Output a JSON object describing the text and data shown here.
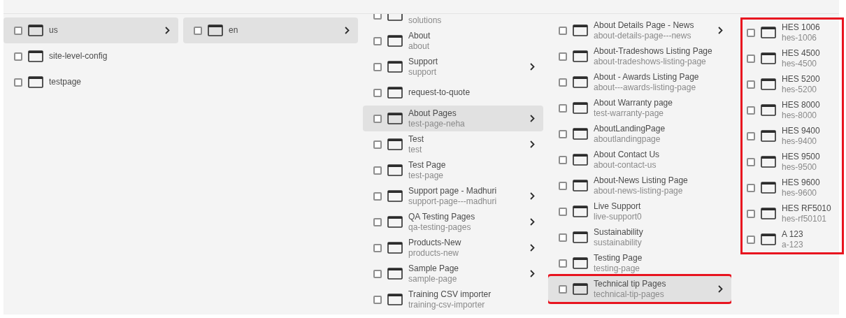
{
  "columns": [
    {
      "highlighted": false,
      "offset": false,
      "items": [
        {
          "title": "us",
          "selected": true,
          "checked": false,
          "has_children": true
        },
        {
          "title": "site-level-config",
          "selected": false,
          "checked": false,
          "has_children": false
        },
        {
          "title": "testpage",
          "selected": false,
          "checked": false,
          "has_children": false
        }
      ]
    },
    {
      "highlighted": false,
      "offset": false,
      "items": [
        {
          "title": "en",
          "selected": true,
          "checked": false,
          "has_children": true
        }
      ]
    },
    {
      "highlighted": false,
      "offset": true,
      "items": [
        {
          "path": "solutions",
          "selected": false,
          "checked": false,
          "has_children": false
        },
        {
          "title": "About",
          "path": "about",
          "selected": false,
          "checked": false,
          "has_children": false
        },
        {
          "title": "Support",
          "path": "support",
          "selected": false,
          "checked": false,
          "has_children": true
        },
        {
          "title": "request-to-quote",
          "selected": false,
          "checked": false,
          "has_children": false
        },
        {
          "title": "About Pages",
          "path": "test-page-neha",
          "selected": true,
          "checked": false,
          "has_children": true
        },
        {
          "title": "Test",
          "path": "test",
          "selected": false,
          "checked": false,
          "has_children": true
        },
        {
          "title": "Test Page",
          "path": "test-page",
          "selected": false,
          "checked": false,
          "has_children": false
        },
        {
          "title": "Support page - Madhuri",
          "path": "support-page---madhuri",
          "selected": false,
          "checked": false,
          "has_children": true
        },
        {
          "title": "QA Testing Pages",
          "path": "qa-testing-pages",
          "selected": false,
          "checked": false,
          "has_children": true
        },
        {
          "title": "Products-New",
          "path": "products-new",
          "selected": false,
          "checked": false,
          "has_children": true
        },
        {
          "title": "Sample Page",
          "path": "sample-page",
          "selected": false,
          "checked": false,
          "has_children": true
        },
        {
          "title": "Training CSV importer",
          "path": "training-csv-importer",
          "selected": false,
          "checked": false,
          "has_children": false
        }
      ]
    },
    {
      "highlighted": false,
      "offset": false,
      "items": [
        {
          "title": "About Details Page - News",
          "path": "about-details-page---news",
          "selected": false,
          "checked": false,
          "has_children": true
        },
        {
          "title": "About-Tradeshows Listing Page",
          "path": "about-tradeshows-listing-page",
          "selected": false,
          "checked": false,
          "has_children": false
        },
        {
          "title": "About - Awards Listing Page",
          "path": "about---awards-listing-page",
          "selected": false,
          "checked": false,
          "has_children": false
        },
        {
          "title": "About Warranty page",
          "path": "test-warranty-page",
          "selected": false,
          "checked": false,
          "has_children": false
        },
        {
          "title": "AboutLandingPage",
          "path": "aboutlandingpage",
          "selected": false,
          "checked": false,
          "has_children": false
        },
        {
          "title": "About Contact Us",
          "path": "about-contact-us",
          "selected": false,
          "checked": false,
          "has_children": false
        },
        {
          "title": "About-News Listing Page",
          "path": "about-news-listing-page",
          "selected": false,
          "checked": false,
          "has_children": false
        },
        {
          "title": "Live Support",
          "path": "live-support0",
          "selected": false,
          "checked": false,
          "has_children": false
        },
        {
          "title": "Sustainability",
          "path": "sustainability",
          "selected": false,
          "checked": false,
          "has_children": false
        },
        {
          "title": "Testing Page",
          "path": "testing-page",
          "selected": false,
          "checked": false,
          "has_children": false
        },
        {
          "title": "Technical tip Pages",
          "path": "technical-tip-pages",
          "selected": true,
          "highlighted": true,
          "checked": false,
          "has_children": true
        }
      ]
    },
    {
      "highlighted": true,
      "offset": false,
      "items": [
        {
          "title": "HES 1006",
          "path": "hes-1006",
          "selected": false,
          "checked": false,
          "has_children": false
        },
        {
          "title": "HES 4500",
          "path": "hes-4500",
          "selected": false,
          "checked": false,
          "has_children": false
        },
        {
          "title": "HES 5200",
          "path": "hes-5200",
          "selected": false,
          "checked": false,
          "has_children": false
        },
        {
          "title": "HES 8000",
          "path": "hes-8000",
          "selected": false,
          "checked": false,
          "has_children": false
        },
        {
          "title": "HES 9400",
          "path": "hes-9400",
          "selected": false,
          "checked": false,
          "has_children": false
        },
        {
          "title": "HES 9500",
          "path": "hes-9500",
          "selected": false,
          "checked": false,
          "has_children": false
        },
        {
          "title": "HES 9600",
          "path": "hes-9600",
          "selected": false,
          "checked": false,
          "has_children": false
        },
        {
          "title": "HES RF5010",
          "path": "hes-rf50101",
          "selected": false,
          "checked": false,
          "has_children": false
        },
        {
          "title": "A 123",
          "path": "a-123",
          "selected": false,
          "checked": false,
          "has_children": false
        }
      ]
    }
  ]
}
